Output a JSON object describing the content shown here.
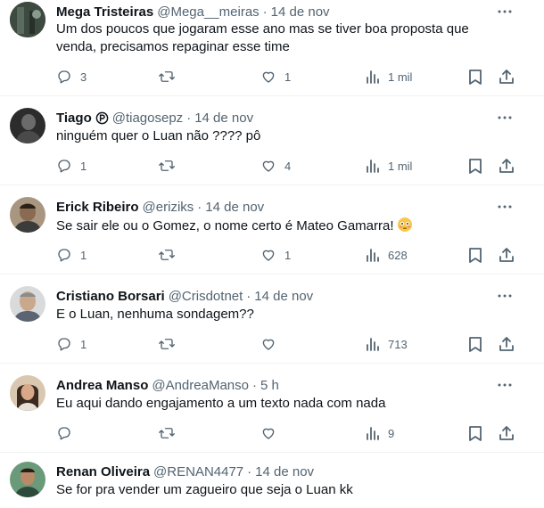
{
  "colors": {
    "text": "#0f1419",
    "secondary": "#536471",
    "divider": "#eff3f4",
    "background": "#ffffff"
  },
  "icons": {
    "reply": "reply-icon",
    "retweet": "retweet-icon",
    "like": "like-icon",
    "views": "views-icon",
    "bookmark": "bookmark-icon",
    "share": "share-icon",
    "more": "more-icon",
    "badge": "verified-badge-icon",
    "emoji": "flushed-face-emoji"
  },
  "replies": [
    {
      "name": "Mega Tristeiras",
      "handle": "@Mega__meiras",
      "time": "14 de nov",
      "text": "Um dos poucos que jogaram esse ano mas se tiver boa proposta que venda, precisamos repaginar esse time",
      "replies": "3",
      "retweets": "",
      "likes": "1",
      "views": "1 mil"
    },
    {
      "name": "Tiago",
      "handle": "@tiagosepz",
      "time": "14 de nov",
      "text": "ninguém quer o Luan não ???? pô",
      "replies": "1",
      "retweets": "",
      "likes": "4",
      "views": "1 mil"
    },
    {
      "name": "Erick Ribeiro",
      "handle": "@eriziks",
      "time": "14 de nov",
      "text": "Se sair ele ou o Gomez, o nome certo é Mateo Gamarra!",
      "replies": "1",
      "retweets": "",
      "likes": "1",
      "views": "628"
    },
    {
      "name": "Cristiano Borsari",
      "handle": "@Crisdotnet",
      "time": "14 de nov",
      "text": "E o Luan, nenhuma sondagem??",
      "replies": "1",
      "retweets": "",
      "likes": "",
      "views": "713"
    },
    {
      "name": "Andrea Manso",
      "handle": "@AndreaManso",
      "time": "5 h",
      "text": "Eu aqui dando engajamento a um texto nada com nada",
      "replies": "",
      "retweets": "",
      "likes": "",
      "views": "9"
    },
    {
      "name": "Renan Oliveira",
      "handle": "@RENAN4477",
      "time": "14 de nov",
      "text": "Se for pra vender um zagueiro que seja o Luan kk",
      "replies": "",
      "retweets": "",
      "likes": "",
      "views": ""
    }
  ]
}
